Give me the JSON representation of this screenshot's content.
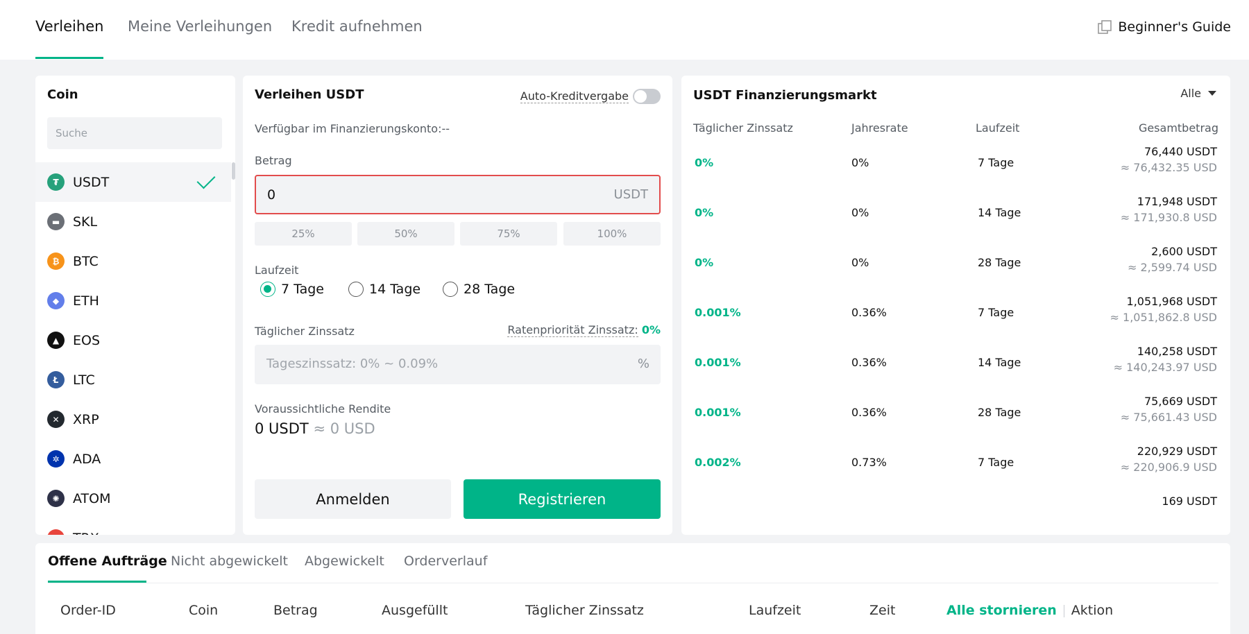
{
  "tabs": {
    "lend": "Verleihen",
    "my_lendings": "Meine Verleihungen",
    "borrow": "Kredit aufnehmen"
  },
  "guide": {
    "label": "Beginner's Guide",
    "icon": "copy-icon"
  },
  "coin_panel": {
    "title": "Coin",
    "search_placeholder": "Suche",
    "coins": [
      {
        "name": "USDT",
        "icon_color": "#26a17b",
        "glyph": "₮",
        "selected": true
      },
      {
        "name": "SKL",
        "icon_color": "#6b6f76",
        "glyph": "▬",
        "selected": false
      },
      {
        "name": "BTC",
        "icon_color": "#f7931a",
        "glyph": "₿",
        "selected": false
      },
      {
        "name": "ETH",
        "icon_color": "#627eea",
        "glyph": "◆",
        "selected": false
      },
      {
        "name": "EOS",
        "icon_color": "#111111",
        "glyph": "▲",
        "selected": false
      },
      {
        "name": "LTC",
        "icon_color": "#345d9d",
        "glyph": "Ł",
        "selected": false
      },
      {
        "name": "XRP",
        "icon_color": "#23292f",
        "glyph": "✕",
        "selected": false
      },
      {
        "name": "ADA",
        "icon_color": "#0033ad",
        "glyph": "✲",
        "selected": false
      },
      {
        "name": "ATOM",
        "icon_color": "#2e3148",
        "glyph": "✺",
        "selected": false
      },
      {
        "name": "TRX",
        "icon_color": "#e8453c",
        "glyph": "▼",
        "selected": false
      }
    ]
  },
  "lend_form": {
    "title": "Verleihen USDT",
    "auto_label": "Auto-Kreditvergabe",
    "available": "Verfügbar im Finanzierungskonto:--",
    "amount_label": "Betrag",
    "amount_value": "0",
    "amount_unit": "USDT",
    "percents": [
      "25%",
      "50%",
      "75%",
      "100%"
    ],
    "term_label": "Laufzeit",
    "terms": [
      "7 Tage",
      "14 Tage",
      "28 Tage"
    ],
    "selected_term": "7 Tage",
    "daily_rate_label": "Täglicher Zinssatz",
    "priority_label": "Ratenpriorität Zinssatz:",
    "priority_value": "0%",
    "rate_placeholder": "Tageszinssatz: 0% ~ 0.09%",
    "rate_unit": "%",
    "return_label": "Voraussichtliche Rendite",
    "return_value": "0 USDT",
    "return_usd": "≈ 0 USD",
    "login_button": "Anmelden",
    "register_button": "Registrieren"
  },
  "market": {
    "title": "USDT Finanzierungsmarkt",
    "filter": "Alle",
    "headers": {
      "daily": "Täglicher Zinssatz",
      "annual": "Jahresrate",
      "term": "Laufzeit",
      "total": "Gesamtbetrag"
    },
    "rows": [
      {
        "daily": "0%",
        "annual": "0%",
        "term": "7 Tage",
        "amount": "76,440 USDT",
        "usd": "≈ 76,432.35 USD"
      },
      {
        "daily": "0%",
        "annual": "0%",
        "term": "14 Tage",
        "amount": "171,948 USDT",
        "usd": "≈ 171,930.8 USD"
      },
      {
        "daily": "0%",
        "annual": "0%",
        "term": "28 Tage",
        "amount": "2,600 USDT",
        "usd": "≈ 2,599.74 USD"
      },
      {
        "daily": "0.001%",
        "annual": "0.36%",
        "term": "7 Tage",
        "amount": "1,051,968 USDT",
        "usd": "≈ 1,051,862.8 USD"
      },
      {
        "daily": "0.001%",
        "annual": "0.36%",
        "term": "14 Tage",
        "amount": "140,258 USDT",
        "usd": "≈ 140,243.97 USD"
      },
      {
        "daily": "0.001%",
        "annual": "0.36%",
        "term": "28 Tage",
        "amount": "75,669 USDT",
        "usd": "≈ 75,661.43 USD"
      },
      {
        "daily": "0.002%",
        "annual": "0.73%",
        "term": "7 Tage",
        "amount": "220,929 USDT",
        "usd": "≈ 220,906.9 USD"
      },
      {
        "daily": "",
        "annual": "",
        "term": "",
        "amount": "169 USDT",
        "usd": ""
      }
    ]
  },
  "orders": {
    "tabs": [
      "Offene Aufträge",
      "Nicht abgewickelt",
      "Abgewickelt",
      "Orderverlauf"
    ],
    "headers": [
      "Order-ID",
      "Coin",
      "Betrag",
      "Ausgefüllt",
      "Täglicher Zinssatz",
      "Laufzeit",
      "Zeit"
    ],
    "cancel_all": "Alle stornieren",
    "action": "Aktion"
  },
  "colors": {
    "accent": "#00b488",
    "error": "#e24c4c"
  }
}
